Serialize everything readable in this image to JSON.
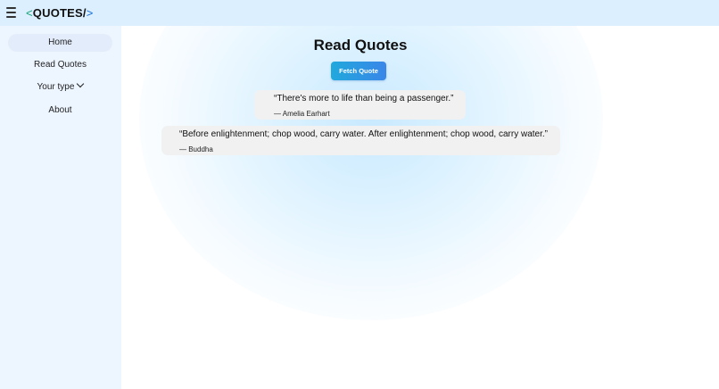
{
  "app": {
    "logo_open": "<",
    "logo_name": "QUOTES/",
    "logo_close": ">",
    "colors": {
      "topbar": "#dcefff",
      "sidebar": "#edf5ff",
      "accent": "#3a86e8",
      "logo_green": "#15a37a"
    }
  },
  "sidebar": {
    "items": [
      {
        "label": "Home"
      },
      {
        "label": "Read Quotes"
      },
      {
        "label": "Your type"
      },
      {
        "label": "About"
      }
    ]
  },
  "main": {
    "title": "Read Quotes",
    "fetch_label": "Fetch Quote",
    "quotes": [
      {
        "text": "“There's more to life than being a passenger.”",
        "author": "— Amelia Earhart"
      },
      {
        "text": "“Before enlightenment; chop wood, carry water. After enlightenment; chop wood, carry water.”",
        "author": "— Buddha"
      }
    ]
  },
  "icons": {
    "menu": "hamburger-menu-icon",
    "dropdown": "chevron-down-icon"
  }
}
